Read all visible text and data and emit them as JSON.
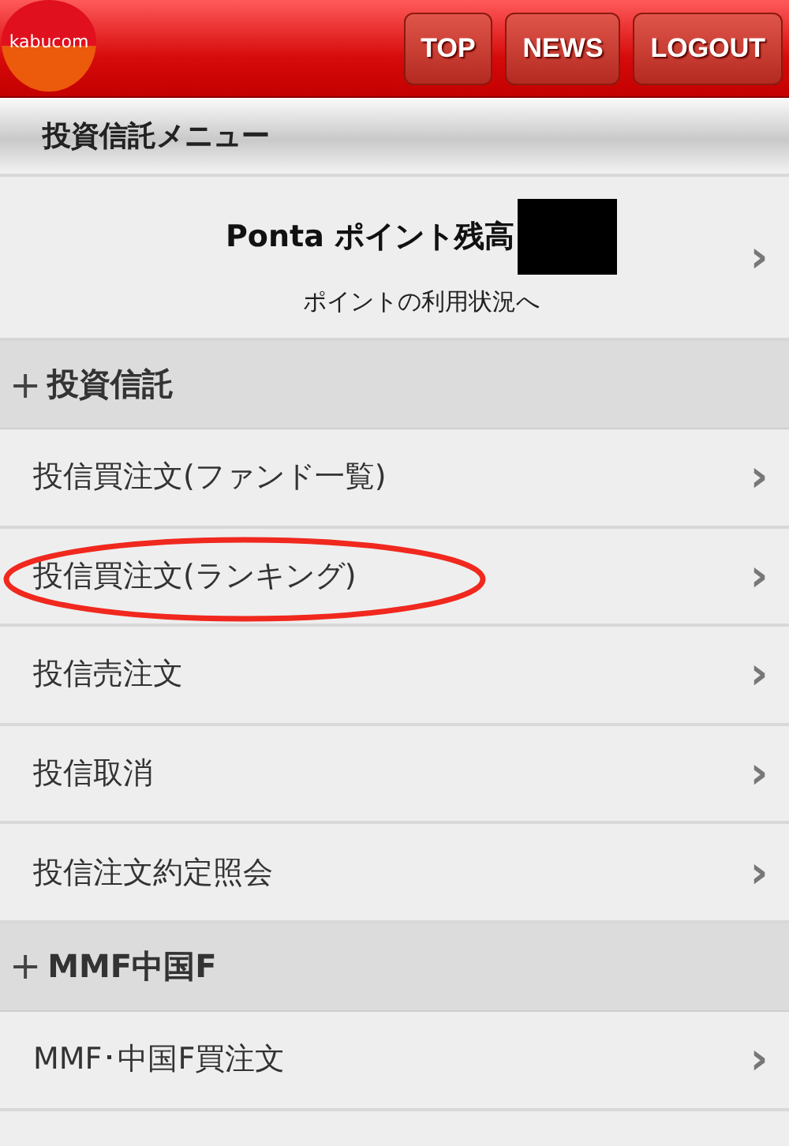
{
  "header": {
    "logo": "kabucom",
    "buttons": [
      "TOP",
      "NEWS",
      "LOGOUT"
    ]
  },
  "title": "投資信託メニュー",
  "points": {
    "label": "Ponta ポイント残高",
    "redacted": true,
    "link": "ポイントの利用状況へ",
    "chevron": "›"
  },
  "sections": [
    {
      "icon": "+",
      "title": "投資信託",
      "items": [
        {
          "label": "投信買注文(ファンド一覧)",
          "highlighted": false,
          "chevron": "›"
        },
        {
          "label": "投信買注文(ランキング)",
          "highlighted": true,
          "chevron": "›"
        },
        {
          "label": "投信売注文",
          "highlighted": false,
          "chevron": "›"
        },
        {
          "label": "投信取消",
          "highlighted": false,
          "chevron": "›"
        },
        {
          "label": "投信注文約定照会",
          "highlighted": false,
          "chevron": "›"
        }
      ]
    },
    {
      "icon": "+",
      "title": "MMF中国F",
      "items": [
        {
          "label": "MMF･中国F買注文",
          "highlighted": false,
          "chevron": "›"
        }
      ]
    }
  ]
}
